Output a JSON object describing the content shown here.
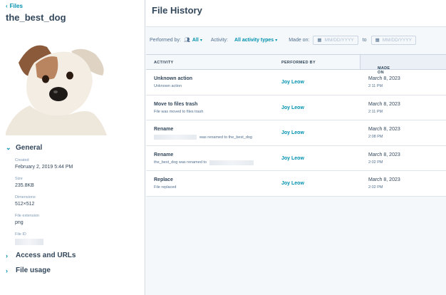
{
  "sidebar": {
    "back_label": "Files",
    "file_name": "the_best_dog",
    "general": {
      "label": "General",
      "created_label": "Created",
      "created_value": "February 2, 2019 5:44 PM",
      "size_label": "Size",
      "size_value": "235.8KB",
      "dimensions_label": "Dimensions",
      "dimensions_value": "512×512",
      "extension_label": "File extension",
      "extension_value": "png",
      "file_id_label": "File ID"
    },
    "access_label": "Access and URLs",
    "usage_label": "File usage"
  },
  "main": {
    "title": "File History",
    "filters": {
      "performed_by_label": "Performed by:",
      "performed_by_value": "All",
      "activity_label": "Activity:",
      "activity_value": "All activity types",
      "made_on_label": "Made on:",
      "date_placeholder": "MM/DD/YYYY",
      "to_label": "to"
    },
    "columns": [
      "ACTIVITY",
      "PERFORMED BY",
      "MADE ON"
    ],
    "rows": [
      {
        "activity": "Unknown action",
        "detail": "Unknown action",
        "performed_by": "Joy Leow",
        "date": "March 8, 2023",
        "time": "2:11 PM"
      },
      {
        "activity": "Move to files trash",
        "detail": "File was moved to files trash",
        "performed_by": "Joy Leow",
        "date": "March 8, 2023",
        "time": "2:11 PM"
      },
      {
        "activity": "Rename",
        "detail": "was renamed to the_best_dog",
        "performed_by": "Joy Leow",
        "date": "March 8, 2023",
        "time": "2:08 PM"
      },
      {
        "activity": "Rename",
        "detail": "the_best_dog was renamed to",
        "performed_by": "Joy Leow",
        "date": "March 8, 2023",
        "time": "2:02 PM"
      },
      {
        "activity": "Replace",
        "detail": "File replaced",
        "performed_by": "Joy Leow",
        "date": "March 8, 2023",
        "time": "2:02 PM"
      }
    ]
  },
  "colors": {
    "accent": "#0091ae",
    "text": "#33475b",
    "border": "#cbd6e2"
  }
}
